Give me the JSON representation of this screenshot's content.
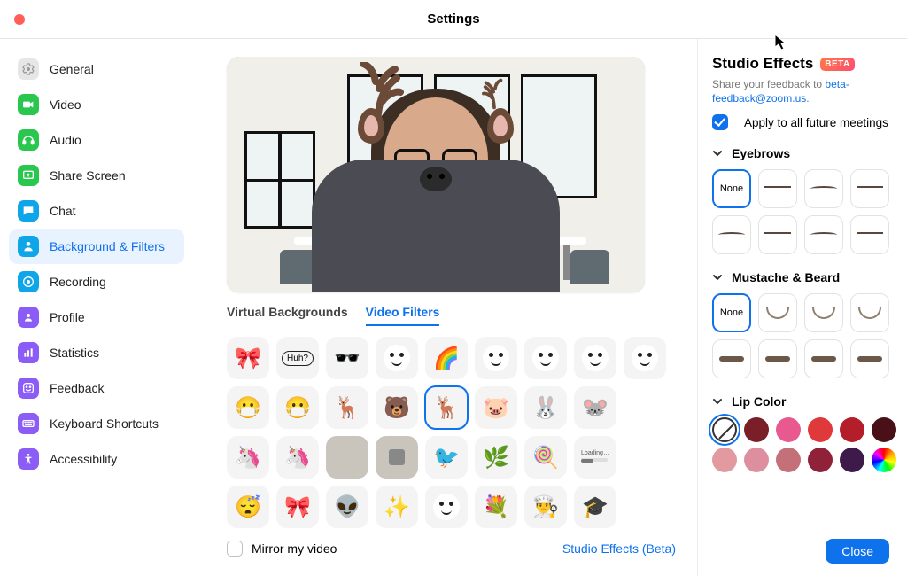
{
  "window": {
    "title": "Settings"
  },
  "sidebar": {
    "items": [
      {
        "key": "general",
        "label": "General",
        "icon": "gear-icon",
        "bg": "#e6e6e6",
        "fg": "#9a9a9a",
        "active": false
      },
      {
        "key": "video",
        "label": "Video",
        "icon": "video-icon",
        "bg": "#2ac74f",
        "fg": "#fff",
        "active": false
      },
      {
        "key": "audio",
        "label": "Audio",
        "icon": "audio-icon",
        "bg": "#2ac74f",
        "fg": "#fff",
        "active": false
      },
      {
        "key": "share",
        "label": "Share Screen",
        "icon": "share-icon",
        "bg": "#2ac74f",
        "fg": "#fff",
        "active": false
      },
      {
        "key": "chat",
        "label": "Chat",
        "icon": "chat-icon",
        "bg": "#0ea5e9",
        "fg": "#fff",
        "active": false
      },
      {
        "key": "bg",
        "label": "Background & Filters",
        "icon": "person-icon",
        "bg": "#0ea5e9",
        "fg": "#fff",
        "active": true
      },
      {
        "key": "recording",
        "label": "Recording",
        "icon": "record-icon",
        "bg": "#0ea5e9",
        "fg": "#fff",
        "active": false
      },
      {
        "key": "profile",
        "label": "Profile",
        "icon": "profile-icon",
        "bg": "#8b5cf6",
        "fg": "#fff",
        "active": false
      },
      {
        "key": "stats",
        "label": "Statistics",
        "icon": "stats-icon",
        "bg": "#8b5cf6",
        "fg": "#fff",
        "active": false
      },
      {
        "key": "feedback",
        "label": "Feedback",
        "icon": "smile-icon",
        "bg": "#8b5cf6",
        "fg": "#fff",
        "active": false
      },
      {
        "key": "shortcuts",
        "label": "Keyboard Shortcuts",
        "icon": "keyboard-icon",
        "bg": "#8b5cf6",
        "fg": "#fff",
        "active": false
      },
      {
        "key": "accessibility",
        "label": "Accessibility",
        "icon": "accessibility-icon",
        "bg": "#8b5cf6",
        "fg": "#fff",
        "active": false
      }
    ]
  },
  "center": {
    "tabs": [
      "Virtual Backgrounds",
      "Video Filters"
    ],
    "active_tab": 1,
    "mirror_label": "Mirror my video",
    "mirror_checked": false,
    "studio_link": "Studio Effects (Beta)",
    "filters": [
      "🎀",
      "Huh?",
      "🕶️",
      "😀",
      "🌈",
      "😆",
      "🙂",
      "🙂",
      "👀",
      "😷",
      "😷",
      "🦌",
      "🐻",
      "🦌",
      "🐷",
      "🐰",
      "🐭",
      "",
      "🦄",
      "🦄",
      "🖼️",
      "👤",
      "🐦",
      "🌿",
      "🍭",
      "Loading…",
      "",
      "😴",
      "🎀",
      "👽",
      "✨",
      "😁",
      "💐",
      "👨‍🍳",
      "🎓",
      ""
    ],
    "selected_filter_index": 13
  },
  "studio": {
    "title": "Studio Effects",
    "beta": "BETA",
    "feedback_pre": "Share your feedback to ",
    "feedback_link": "beta-feedback@zoom.us",
    "feedback_post": ".",
    "apply_label": "Apply to all future meetings",
    "apply_checked": true,
    "sections": {
      "eyebrows": {
        "title": "Eyebrows",
        "options": [
          "None",
          "brow1",
          "brow2",
          "brow3",
          "brow4",
          "brow5",
          "brow6",
          "brow7"
        ],
        "selected": 0
      },
      "mustache": {
        "title": "Mustache & Beard",
        "options": [
          "None",
          "mb1",
          "mb2",
          "mb3",
          "mb4",
          "mb5",
          "mb6",
          "mb7"
        ],
        "selected": 0
      },
      "lip": {
        "title": "Lip Color",
        "options": [
          "none",
          "#7a1f28",
          "#e85a8f",
          "#e0393b",
          "#b41e2b",
          "#4a1017",
          "#e29aa0",
          "#dd8fa0",
          "#c37079",
          "#8f2238",
          "#3d1a4a",
          "rainbow"
        ],
        "selected": 0
      }
    }
  },
  "close_label": "Close"
}
